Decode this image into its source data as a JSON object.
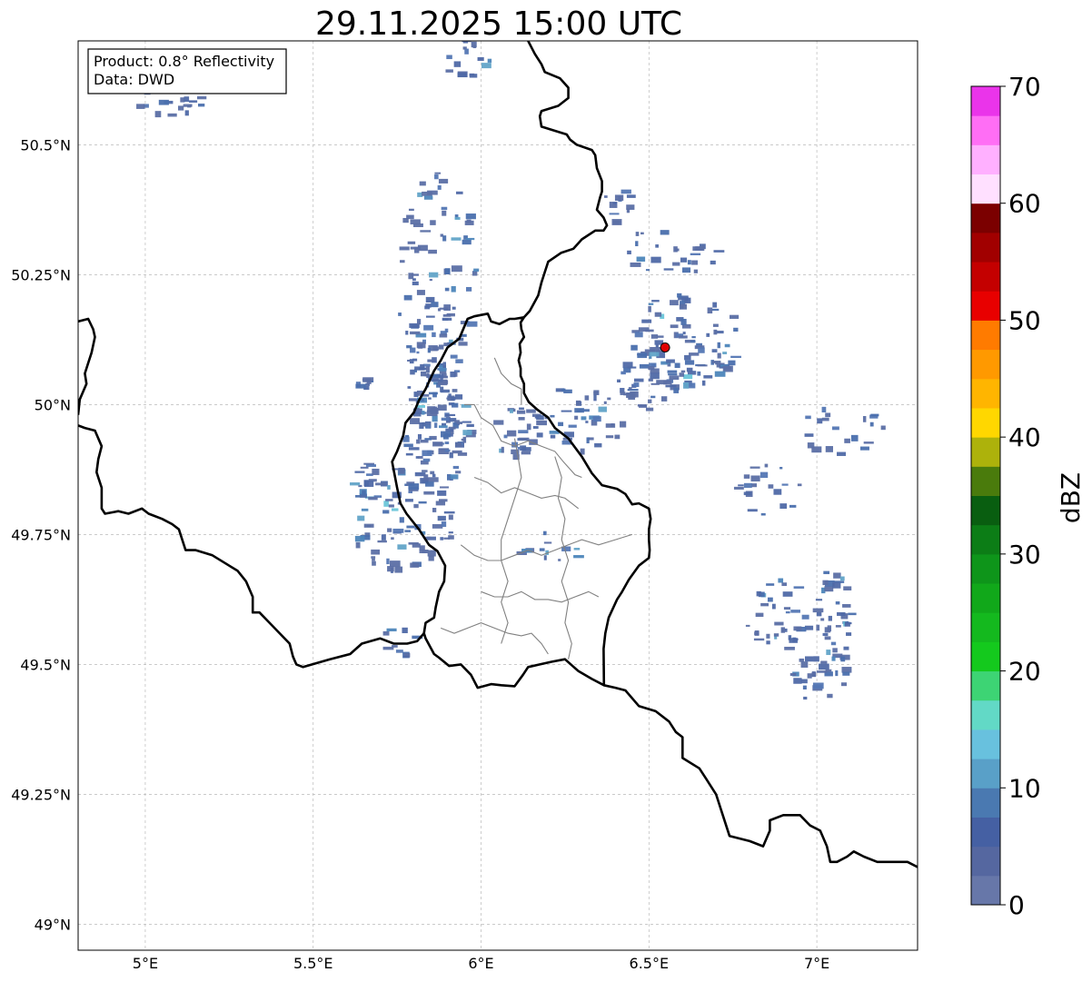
{
  "title": "29.11.2025 15:00 UTC",
  "info": {
    "product": "Product: 0.8° Reflectivity",
    "data": "Data: DWD"
  },
  "map": {
    "lon_range": [
      4.8,
      7.3
    ],
    "lat_range": [
      48.95,
      50.7
    ],
    "grid": true,
    "x_ticks": [
      {
        "value": 5.0,
        "label": "5°E"
      },
      {
        "value": 5.5,
        "label": "5.5°E"
      },
      {
        "value": 6.0,
        "label": "6°E"
      },
      {
        "value": 6.5,
        "label": "6.5°E"
      },
      {
        "value": 7.0,
        "label": "7°E"
      }
    ],
    "y_ticks": [
      {
        "value": 50.5,
        "label": "50.5°N"
      },
      {
        "value": 50.25,
        "label": "50.25°N"
      },
      {
        "value": 50.0,
        "label": "50°N"
      },
      {
        "value": 49.75,
        "label": "49.75°N"
      },
      {
        "value": 49.5,
        "label": "49.5°N"
      },
      {
        "value": 49.25,
        "label": "49.25°N"
      },
      {
        "value": 49.0,
        "label": "49°N"
      }
    ],
    "radar_site": {
      "lon": 6.548,
      "lat": 50.11,
      "color": "#e00000"
    }
  },
  "borders": {
    "luxembourg": [
      [
        6.128,
        50.168
      ],
      [
        6.118,
        50.158
      ],
      [
        6.12,
        50.145
      ],
      [
        6.128,
        50.13
      ],
      [
        6.115,
        50.117
      ],
      [
        6.118,
        50.1
      ],
      [
        6.112,
        50.085
      ],
      [
        6.118,
        50.07
      ],
      [
        6.118,
        50.055
      ],
      [
        6.128,
        50.04
      ],
      [
        6.128,
        50.022
      ],
      [
        6.142,
        50.005
      ],
      [
        6.168,
        49.99
      ],
      [
        6.2,
        49.975
      ],
      [
        6.22,
        49.955
      ],
      [
        6.26,
        49.935
      ],
      [
        6.3,
        49.9
      ],
      [
        6.33,
        49.868
      ],
      [
        6.36,
        49.845
      ],
      [
        6.405,
        49.838
      ],
      [
        6.43,
        49.828
      ],
      [
        6.45,
        49.808
      ],
      [
        6.47,
        49.81
      ],
      [
        6.5,
        49.8
      ],
      [
        6.505,
        49.78
      ],
      [
        6.5,
        49.76
      ],
      [
        6.5,
        49.74
      ],
      [
        6.502,
        49.72
      ],
      [
        6.5,
        49.705
      ],
      [
        6.47,
        49.69
      ],
      [
        6.44,
        49.663
      ],
      [
        6.42,
        49.64
      ],
      [
        6.405,
        49.625
      ],
      [
        6.38,
        49.59
      ],
      [
        6.37,
        49.56
      ],
      [
        6.365,
        49.53
      ],
      [
        6.366,
        49.46
      ],
      [
        6.33,
        49.472
      ],
      [
        6.29,
        49.487
      ],
      [
        6.25,
        49.51
      ],
      [
        6.21,
        49.505
      ],
      [
        6.175,
        49.5
      ],
      [
        6.14,
        49.495
      ],
      [
        6.125,
        49.48
      ],
      [
        6.1,
        49.458
      ],
      [
        6.06,
        49.46
      ],
      [
        6.03,
        49.462
      ],
      [
        5.99,
        49.455
      ],
      [
        5.97,
        49.48
      ],
      [
        5.94,
        49.5
      ],
      [
        5.905,
        49.497
      ],
      [
        5.875,
        49.513
      ],
      [
        5.86,
        49.52
      ],
      [
        5.835,
        49.55
      ],
      [
        5.83,
        49.56
      ],
      [
        5.835,
        49.58
      ],
      [
        5.86,
        49.59
      ],
      [
        5.865,
        49.61
      ],
      [
        5.875,
        49.64
      ],
      [
        5.89,
        49.66
      ],
      [
        5.893,
        49.69
      ],
      [
        5.87,
        49.718
      ],
      [
        5.845,
        49.73
      ],
      [
        5.815,
        49.76
      ],
      [
        5.778,
        49.79
      ],
      [
        5.76,
        49.81
      ],
      [
        5.75,
        49.84
      ],
      [
        5.735,
        49.89
      ],
      [
        5.75,
        49.91
      ],
      [
        5.768,
        49.94
      ],
      [
        5.775,
        49.965
      ],
      [
        5.8,
        49.985
      ],
      [
        5.815,
        50.008
      ],
      [
        5.835,
        50.03
      ],
      [
        5.86,
        50.065
      ],
      [
        5.88,
        50.085
      ],
      [
        5.9,
        50.11
      ],
      [
        5.935,
        50.127
      ],
      [
        5.96,
        50.165
      ],
      [
        5.98,
        50.17
      ],
      [
        6.02,
        50.175
      ],
      [
        6.03,
        50.16
      ],
      [
        6.055,
        50.155
      ],
      [
        6.085,
        50.165
      ],
      [
        6.1,
        50.165
      ],
      [
        6.128,
        50.168
      ]
    ],
    "be_de_north": [
      [
        6.128,
        50.168
      ],
      [
        6.145,
        50.18
      ],
      [
        6.17,
        50.21
      ],
      [
        6.18,
        50.235
      ],
      [
        6.19,
        50.255
      ],
      [
        6.2,
        50.275
      ],
      [
        6.238,
        50.292
      ],
      [
        6.275,
        50.3
      ],
      [
        6.3,
        50.318
      ],
      [
        6.34,
        50.335
      ],
      [
        6.365,
        50.335
      ],
      [
        6.375,
        50.345
      ],
      [
        6.365,
        50.36
      ],
      [
        6.345,
        50.375
      ],
      [
        6.355,
        50.4
      ],
      [
        6.36,
        50.41
      ],
      [
        6.36,
        50.43
      ],
      [
        6.345,
        50.455
      ],
      [
        6.34,
        50.48
      ],
      [
        6.33,
        50.49
      ],
      [
        6.285,
        50.5
      ],
      [
        6.265,
        50.51
      ],
      [
        6.255,
        50.52
      ],
      [
        6.23,
        50.525
      ],
      [
        6.18,
        50.535
      ],
      [
        6.175,
        50.555
      ],
      [
        6.18,
        50.565
      ],
      [
        6.23,
        50.575
      ],
      [
        6.26,
        50.59
      ],
      [
        6.26,
        50.61
      ],
      [
        6.235,
        50.628
      ],
      [
        6.19,
        50.64
      ],
      [
        6.18,
        50.655
      ],
      [
        6.16,
        50.675
      ],
      [
        6.14,
        50.7
      ]
    ],
    "fr_be": [
      [
        4.8,
        49.96
      ],
      [
        4.82,
        49.955
      ],
      [
        4.85,
        49.95
      ],
      [
        4.87,
        49.92
      ],
      [
        4.86,
        49.895
      ],
      [
        4.855,
        49.87
      ],
      [
        4.87,
        49.84
      ],
      [
        4.87,
        49.8
      ],
      [
        4.88,
        49.79
      ],
      [
        4.92,
        49.795
      ],
      [
        4.95,
        49.79
      ],
      [
        4.99,
        49.8
      ],
      [
        5.01,
        49.79
      ],
      [
        5.05,
        49.78
      ],
      [
        5.08,
        49.77
      ],
      [
        5.1,
        49.76
      ],
      [
        5.12,
        49.72
      ],
      [
        5.15,
        49.72
      ],
      [
        5.2,
        49.71
      ],
      [
        5.25,
        49.69
      ],
      [
        5.275,
        49.68
      ],
      [
        5.3,
        49.66
      ],
      [
        5.32,
        49.63
      ],
      [
        5.32,
        49.6
      ],
      [
        5.34,
        49.6
      ],
      [
        5.37,
        49.58
      ],
      [
        5.4,
        49.56
      ],
      [
        5.43,
        49.54
      ],
      [
        5.44,
        49.515
      ],
      [
        5.45,
        49.5
      ],
      [
        5.47,
        49.495
      ],
      [
        5.55,
        49.51
      ],
      [
        5.61,
        49.52
      ],
      [
        5.645,
        49.54
      ],
      [
        5.7,
        49.55
      ],
      [
        5.74,
        49.54
      ],
      [
        5.78,
        49.54
      ],
      [
        5.81,
        49.545
      ],
      [
        5.83,
        49.56
      ]
    ],
    "fr_de": [
      [
        6.366,
        49.46
      ],
      [
        6.4,
        49.455
      ],
      [
        6.43,
        49.45
      ],
      [
        6.47,
        49.42
      ],
      [
        6.52,
        49.41
      ],
      [
        6.56,
        49.39
      ],
      [
        6.58,
        49.37
      ],
      [
        6.6,
        49.36
      ],
      [
        6.6,
        49.32
      ],
      [
        6.65,
        49.3
      ],
      [
        6.67,
        49.28
      ],
      [
        6.7,
        49.25
      ],
      [
        6.72,
        49.21
      ],
      [
        6.74,
        49.17
      ],
      [
        6.8,
        49.16
      ],
      [
        6.84,
        49.15
      ],
      [
        6.86,
        49.18
      ],
      [
        6.86,
        49.2
      ],
      [
        6.9,
        49.21
      ],
      [
        6.95,
        49.21
      ],
      [
        6.98,
        49.19
      ],
      [
        7.01,
        49.18
      ],
      [
        7.03,
        49.15
      ],
      [
        7.04,
        49.12
      ],
      [
        7.06,
        49.12
      ],
      [
        7.09,
        49.13
      ],
      [
        7.11,
        49.14
      ],
      [
        7.14,
        49.13
      ],
      [
        7.18,
        49.12
      ],
      [
        7.22,
        49.12
      ],
      [
        7.27,
        49.12
      ],
      [
        7.3,
        49.11
      ]
    ],
    "be_nl_west": [
      [
        4.8,
        50.16
      ],
      [
        4.83,
        50.165
      ],
      [
        4.845,
        50.145
      ],
      [
        4.85,
        50.13
      ],
      [
        4.84,
        50.1
      ],
      [
        4.83,
        50.08
      ],
      [
        4.82,
        50.06
      ],
      [
        4.825,
        50.04
      ],
      [
        4.805,
        50.01
      ],
      [
        4.8,
        49.98
      ]
    ],
    "lux_cantons": [
      [
        [
          5.95,
          50.0
        ],
        [
          5.98,
          50.0
        ],
        [
          6.0,
          49.975
        ],
        [
          6.035,
          49.96
        ],
        [
          6.06,
          49.93
        ],
        [
          6.1,
          49.92
        ],
        [
          6.14,
          49.93
        ],
        [
          6.18,
          49.92
        ],
        [
          6.22,
          49.91
        ],
        [
          6.245,
          49.89
        ],
        [
          6.28,
          49.865
        ],
        [
          6.3,
          49.86
        ]
      ],
      [
        [
          5.98,
          49.86
        ],
        [
          6.02,
          49.85
        ],
        [
          6.06,
          49.83
        ],
        [
          6.1,
          49.84
        ],
        [
          6.14,
          49.83
        ],
        [
          6.18,
          49.82
        ],
        [
          6.22,
          49.825
        ],
        [
          6.25,
          49.82
        ],
        [
          6.27,
          49.81
        ],
        [
          6.29,
          49.8
        ]
      ],
      [
        [
          5.94,
          49.73
        ],
        [
          5.98,
          49.71
        ],
        [
          6.02,
          49.7
        ],
        [
          6.06,
          49.7
        ],
        [
          6.1,
          49.71
        ],
        [
          6.14,
          49.72
        ],
        [
          6.18,
          49.71
        ],
        [
          6.22,
          49.72
        ],
        [
          6.26,
          49.73
        ],
        [
          6.3,
          49.74
        ],
        [
          6.35,
          49.73
        ],
        [
          6.4,
          49.74
        ],
        [
          6.45,
          49.75
        ]
      ],
      [
        [
          6.0,
          49.64
        ],
        [
          6.04,
          49.63
        ],
        [
          6.08,
          49.63
        ],
        [
          6.12,
          49.64
        ],
        [
          6.16,
          49.625
        ],
        [
          6.2,
          49.625
        ],
        [
          6.24,
          49.62
        ],
        [
          6.28,
          49.63
        ],
        [
          6.32,
          49.64
        ],
        [
          6.35,
          49.63
        ]
      ],
      [
        [
          5.88,
          49.57
        ],
        [
          5.92,
          49.56
        ],
        [
          5.96,
          49.57
        ],
        [
          6.0,
          49.58
        ],
        [
          6.04,
          49.57
        ],
        [
          6.08,
          49.56
        ],
        [
          6.12,
          49.555
        ],
        [
          6.15,
          49.56
        ],
        [
          6.18,
          49.54
        ],
        [
          6.2,
          49.52
        ]
      ],
      [
        [
          6.1,
          49.935
        ],
        [
          6.11,
          49.9
        ],
        [
          6.12,
          49.86
        ],
        [
          6.1,
          49.82
        ],
        [
          6.08,
          49.78
        ],
        [
          6.06,
          49.74
        ],
        [
          6.06,
          49.7
        ],
        [
          6.08,
          49.66
        ],
        [
          6.06,
          49.62
        ],
        [
          6.08,
          49.58
        ],
        [
          6.06,
          49.54
        ]
      ],
      [
        [
          6.22,
          49.9
        ],
        [
          6.24,
          49.86
        ],
        [
          6.23,
          49.82
        ],
        [
          6.25,
          49.78
        ],
        [
          6.24,
          49.74
        ],
        [
          6.26,
          49.7
        ],
        [
          6.24,
          49.66
        ],
        [
          6.26,
          49.62
        ],
        [
          6.25,
          49.58
        ],
        [
          6.27,
          49.54
        ],
        [
          6.26,
          49.51
        ]
      ],
      [
        [
          6.04,
          50.09
        ],
        [
          6.06,
          50.06
        ],
        [
          6.09,
          50.04
        ],
        [
          6.12,
          50.03
        ],
        [
          6.12,
          50.0
        ]
      ]
    ]
  },
  "echoes": {
    "blobs": [
      {
        "lon": 5.86,
        "lat": 50.25,
        "rlon": 0.12,
        "rlat": 0.2,
        "n": 90,
        "seed": 11
      },
      {
        "lon": 5.86,
        "lat": 50.08,
        "rlon": 0.09,
        "rlat": 0.12,
        "n": 70,
        "seed": 12
      },
      {
        "lon": 5.86,
        "lat": 49.95,
        "rlon": 0.1,
        "rlat": 0.1,
        "n": 80,
        "seed": 13
      },
      {
        "lon": 5.76,
        "lat": 49.78,
        "rlon": 0.15,
        "rlat": 0.1,
        "n": 85,
        "seed": 14
      },
      {
        "lon": 5.65,
        "lat": 49.86,
        "rlon": 0.05,
        "rlat": 0.04,
        "n": 15,
        "seed": 15
      },
      {
        "lon": 6.1,
        "lat": 49.95,
        "rlon": 0.08,
        "rlat": 0.05,
        "n": 30,
        "seed": 16
      },
      {
        "lon": 6.3,
        "lat": 49.98,
        "rlon": 0.12,
        "rlat": 0.07,
        "n": 40,
        "seed": 17
      },
      {
        "lon": 6.6,
        "lat": 50.13,
        "rlon": 0.16,
        "rlat": 0.09,
        "n": 90,
        "seed": 18
      },
      {
        "lon": 6.5,
        "lat": 50.05,
        "rlon": 0.1,
        "rlat": 0.06,
        "n": 40,
        "seed": 19
      },
      {
        "lon": 6.55,
        "lat": 50.3,
        "rlon": 0.15,
        "rlat": 0.05,
        "n": 25,
        "seed": 20
      },
      {
        "lon": 5.95,
        "lat": 50.68,
        "rlon": 0.08,
        "rlat": 0.05,
        "n": 20,
        "seed": 21
      },
      {
        "lon": 5.08,
        "lat": 50.62,
        "rlon": 0.15,
        "rlat": 0.06,
        "n": 45,
        "seed": 22
      },
      {
        "lon": 6.88,
        "lat": 49.6,
        "rlon": 0.1,
        "rlat": 0.07,
        "n": 35,
        "seed": 23
      },
      {
        "lon": 7.04,
        "lat": 49.6,
        "rlon": 0.06,
        "rlat": 0.1,
        "n": 40,
        "seed": 24
      },
      {
        "lon": 7.0,
        "lat": 49.48,
        "rlon": 0.08,
        "rlat": 0.05,
        "n": 25,
        "seed": 25
      },
      {
        "lon": 6.85,
        "lat": 49.84,
        "rlon": 0.1,
        "rlat": 0.05,
        "n": 20,
        "seed": 26
      },
      {
        "lon": 7.05,
        "lat": 49.95,
        "rlon": 0.15,
        "rlat": 0.05,
        "n": 20,
        "seed": 27
      },
      {
        "lon": 6.4,
        "lat": 50.38,
        "rlon": 0.05,
        "rlat": 0.04,
        "n": 12,
        "seed": 28
      },
      {
        "lon": 6.2,
        "lat": 49.72,
        "rlon": 0.1,
        "rlat": 0.04,
        "n": 12,
        "seed": 29
      },
      {
        "lon": 5.65,
        "lat": 50.06,
        "rlon": 0.04,
        "rlat": 0.03,
        "n": 8,
        "seed": 30
      },
      {
        "lon": 5.75,
        "lat": 49.55,
        "rlon": 0.05,
        "rlat": 0.04,
        "n": 10,
        "seed": 31
      }
    ],
    "palette": [
      "#5b6fa5",
      "#4f69a6",
      "#4a6fad",
      "#5477b4",
      "#4d86bb",
      "#62a4c8",
      "#6ac6d9"
    ]
  },
  "colorbar": {
    "label": "dBZ",
    "min": 0,
    "max": 70,
    "step": 2.5,
    "ticks": [
      {
        "value": 0,
        "label": "0"
      },
      {
        "value": 10,
        "label": "10"
      },
      {
        "value": 20,
        "label": "20"
      },
      {
        "value": 30,
        "label": "30"
      },
      {
        "value": 40,
        "label": "40"
      },
      {
        "value": 50,
        "label": "50"
      },
      {
        "value": 60,
        "label": "60"
      },
      {
        "value": 70,
        "label": "70"
      }
    ],
    "colors": [
      "#6777a9",
      "#5567a0",
      "#4560a3",
      "#4a79b1",
      "#59a0c8",
      "#68c1de",
      "#62d9c6",
      "#3dd474",
      "#14c91d",
      "#14b91e",
      "#11a81a",
      "#0e951a",
      "#0c7d16",
      "#095e10",
      "#4a7b0c",
      "#adb20b",
      "#ffd700",
      "#ffb500",
      "#ff9900",
      "#ff7b00",
      "#e80000",
      "#c40000",
      "#a10000",
      "#7b0000",
      "#ffe0ff",
      "#ffb0ff",
      "#ff6ef5",
      "#ea34ea"
    ]
  }
}
